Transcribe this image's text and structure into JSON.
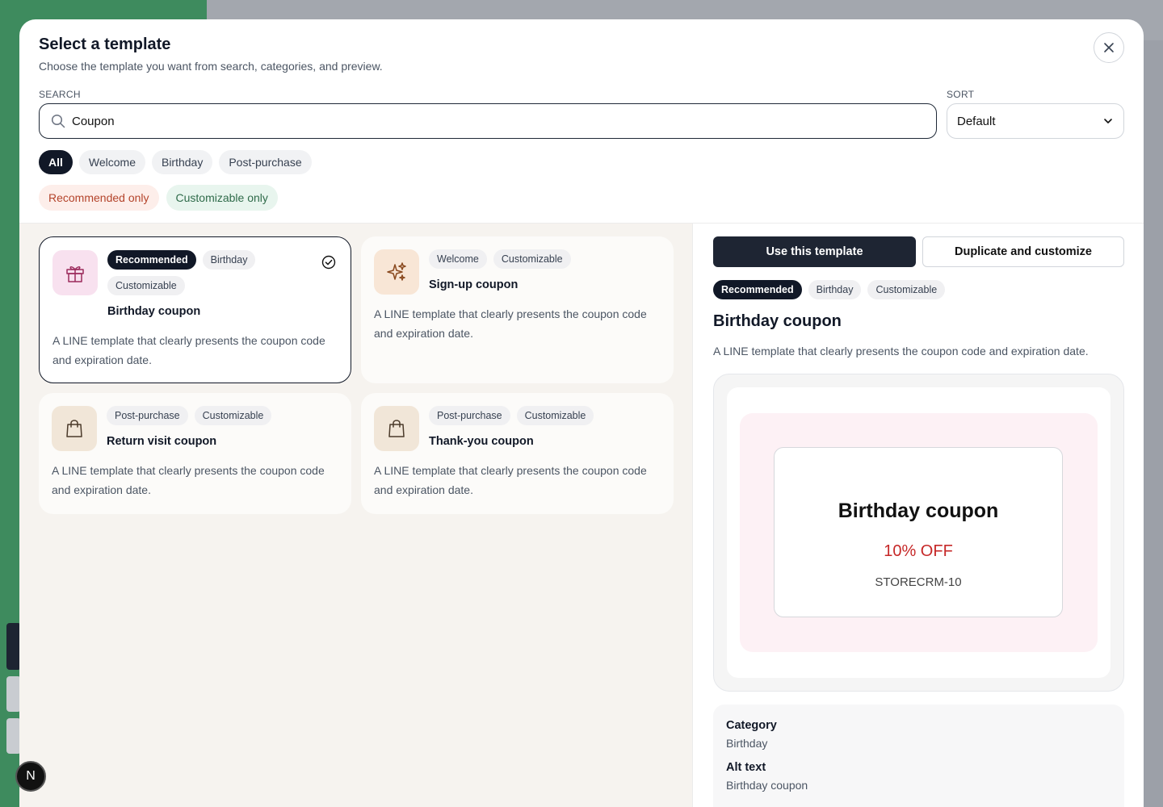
{
  "modal": {
    "title": "Select a template",
    "subtitle": "Choose the template you want from search, categories, and preview."
  },
  "search": {
    "label": "SEARCH",
    "value": "Coupon"
  },
  "sort": {
    "label": "SORT",
    "value": "Default"
  },
  "categories": [
    "All",
    "Welcome",
    "Birthday",
    "Post-purchase"
  ],
  "active_category": "All",
  "filters": {
    "recommended": "Recommended only",
    "customizable": "Customizable only"
  },
  "cards": [
    {
      "tags": [
        "Recommended",
        "Birthday",
        "Customizable"
      ],
      "name": "Birthday coupon",
      "desc": "A LINE template that clearly presents the coupon code and expiration date.",
      "icon": "gift-icon",
      "icon_bg": "#f8e1ef",
      "selected": true
    },
    {
      "tags": [
        "Welcome",
        "Customizable"
      ],
      "name": "Sign-up coupon",
      "desc": "A LINE template that clearly presents the coupon code and expiration date.",
      "icon": "sparkles-icon",
      "icon_bg": "#f8e6d6",
      "selected": false
    },
    {
      "tags": [
        "Post-purchase",
        "Customizable"
      ],
      "name": "Return visit coupon",
      "desc": "A LINE template that clearly presents the coupon code and expiration date.",
      "icon": "shopping-bag-icon",
      "icon_bg": "#f1e6d8",
      "selected": false
    },
    {
      "tags": [
        "Post-purchase",
        "Customizable"
      ],
      "name": "Thank-you coupon",
      "desc": "A LINE template that clearly presents the coupon code and expiration date.",
      "icon": "shopping-bag-icon",
      "icon_bg": "#f1e6d8",
      "selected": false
    }
  ],
  "detail": {
    "use_button": "Use this template",
    "duplicate_button": "Duplicate and customize",
    "tags": [
      "Recommended",
      "Birthday",
      "Customizable"
    ],
    "name": "Birthday coupon",
    "desc": "A LINE template that clearly presents the coupon code and expiration date.",
    "preview": {
      "title": "Birthday coupon",
      "discount": "10% OFF",
      "code": "STORECRM-10"
    },
    "meta": {
      "category_label": "Category",
      "category_value": "Birthday",
      "alt_label": "Alt text",
      "alt_value": "Birthday coupon"
    }
  },
  "dev_badge": "N",
  "colors": {
    "primary": "#1e2533",
    "recommended_text": "#b4442b",
    "customizable_text": "#2f6b4a",
    "discount": "#c62828"
  }
}
